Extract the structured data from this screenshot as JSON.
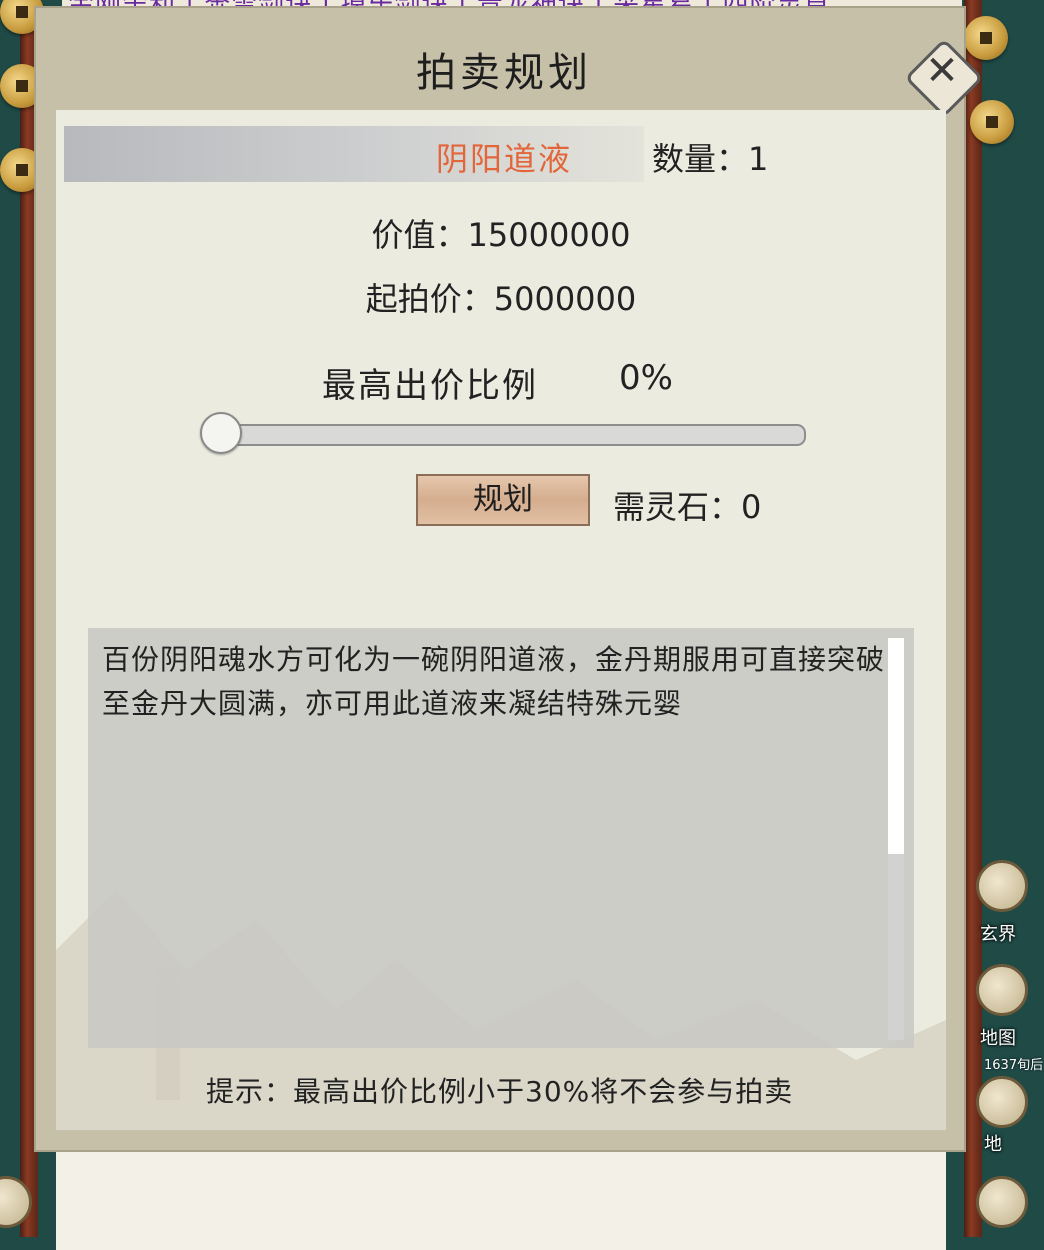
{
  "background": {
    "top_menu_text": "金刚舍利 | 奔雷剑诀 | 摸乐剑诀 | 青龙神诀 | 采星易 | 四阶灵草",
    "side_labels": [
      "玄界",
      "地图",
      "1637旬后",
      "地"
    ]
  },
  "dialog": {
    "title": "拍卖规划",
    "close_icon": "close-icon",
    "item": {
      "name": "阴阳道液",
      "quantity_text": "数量：1"
    },
    "value_text": "价值：15000000",
    "start_price_text": "起拍价：5000000",
    "max_bid_ratio": {
      "label": "最高出价比例",
      "value_text": "0%",
      "value": 0
    },
    "plan_button_label": "规划",
    "cost_text": "需灵石：0",
    "description": "百份阴阳魂水方可化为一碗阴阳道液，金丹期服用可直接突破至金丹大圆满，亦可用此道液来凝结特殊元婴",
    "hint": "提示：最高出价比例小于30%将不会参与拍卖"
  },
  "colors": {
    "item_name": "#e3663b",
    "dialog_bg": "#c6c0a8",
    "paper_bg": "#ecebe0"
  }
}
